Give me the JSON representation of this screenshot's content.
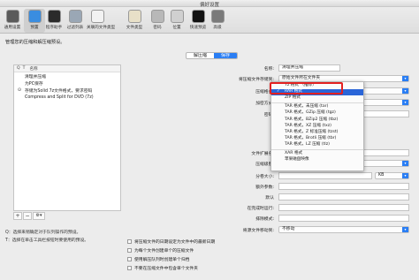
{
  "window": {
    "title": "偏好设置"
  },
  "toolbar": {
    "items": [
      {
        "label": "通用设置",
        "color": "#5a5a5a"
      },
      {
        "label": "预置",
        "color": "#3a8de0"
      },
      {
        "label": "程序助手",
        "color": "#2b2b2b"
      },
      {
        "label": "过滤列表",
        "color": "#9aa7b5"
      },
      {
        "label": "关联的文件类型",
        "color": "#f2f2f2"
      },
      {
        "label": "文件类型",
        "color": "#e8e0c8"
      },
      {
        "label": "密码",
        "color": "#b8b8b8"
      },
      {
        "label": "位置",
        "color": "#d0d0d0"
      },
      {
        "label": "快速预览",
        "color": "#111111"
      },
      {
        "label": "高级",
        "color": "#7a7a7a"
      }
    ]
  },
  "intro_text": "管理您的压缩和解压缩预设。",
  "tabs": {
    "decompress": "解压缩",
    "save": "保存"
  },
  "list": {
    "headers": [
      "Q",
      "T",
      "名称"
    ],
    "items": [
      {
        "mark": "",
        "name": "清理并压缩"
      },
      {
        "mark": "",
        "name": "为PC保存"
      },
      {
        "mark": "⊙",
        "name": "存储为Solid 7z文件格式，要求密码"
      },
      {
        "mark": "",
        "name": "Compress and Split for DVD (7z)"
      }
    ],
    "footer": {
      "add": "+",
      "remove": "−",
      "gear": "⚙▾"
    }
  },
  "notes": {
    "q": "Q：选择来稍确定对于队列操作的预设。",
    "t": "T：选择在单击工具栏按钮时要使用的预设。"
  },
  "form": {
    "name_label": "名称:",
    "name_value": "清理并压缩",
    "save_location_label": "将压缩文件存储到:",
    "save_location_value": "原始文件所在文件夹",
    "compress_format_label": "压缩格式:",
    "compress_format_value": "7z 格式",
    "encryption_label": "加密方式:",
    "password_label": "密码:",
    "extension_label": "文件扩展名:",
    "level_label": "压缩级别:",
    "split_label": "分卷大小:",
    "split_unit": "KB",
    "split_default": "默认",
    "comment_label": "额外参数:",
    "after_label": "在完成时运行:",
    "exclude_label": "排除模式:",
    "source_action_label": "将源文件移动到:",
    "source_action_value": "不移动",
    "checkboxes": [
      "将压缩文件的日期设定为文件中的最新日期",
      "为每个文件创建单个的压缩文件",
      "使用解压队列时创建单个归档",
      "不要在压缩文件中包含单个文件夹"
    ]
  },
  "menu": {
    "items": [
      {
        "label": "7z 格式 （推荐）",
        "type": "item"
      },
      {
        "label": "RAR 格式",
        "type": "selected",
        "check": "✓"
      },
      {
        "label": "ZIP 格式",
        "type": "item"
      },
      {
        "type": "sep"
      },
      {
        "label": "TAR 格式，未压缩 (tar)",
        "type": "item"
      },
      {
        "label": "TAR 格式，GZip 压缩 (tgz)",
        "type": "item"
      },
      {
        "label": "TAR 格式，BZip2 压缩 (tbz)",
        "type": "item"
      },
      {
        "label": "TAR 格式，XZ 压缩 (txz)",
        "type": "item"
      },
      {
        "label": "TAR 格式，Z 标准压缩 (tzst)",
        "type": "item"
      },
      {
        "label": "TAR 格式，Brotli 压缩 (tbr)",
        "type": "item"
      },
      {
        "label": "TAR 格式，LZ 压缩 (tlz)",
        "type": "item"
      },
      {
        "type": "sep"
      },
      {
        "label": "XAR 格式",
        "type": "item"
      },
      {
        "label": "苹果磁盘映像",
        "type": "item"
      }
    ]
  },
  "colors": {
    "accent": "#2a7ef4",
    "highlight": "#e32020",
    "menu_selected": "#2a65d8"
  }
}
